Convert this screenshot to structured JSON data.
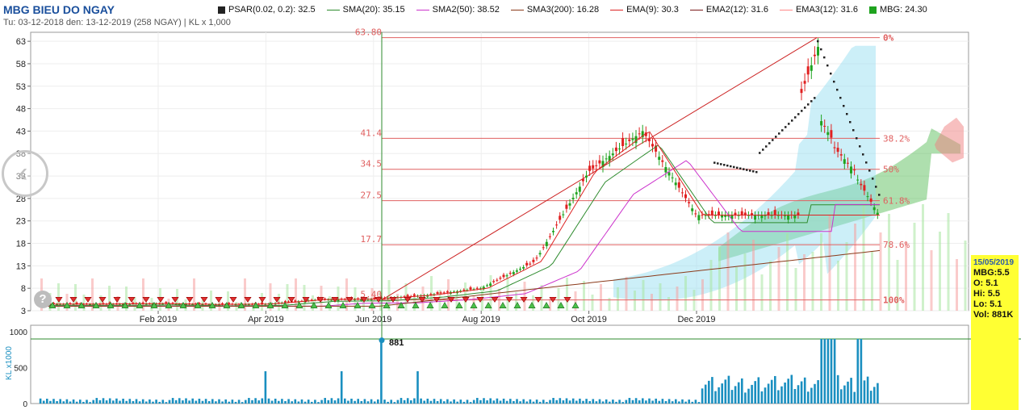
{
  "title": "MBG BIEU DO NGAY",
  "subtitle": "Tu: 03-12-2018 den: 13-12-2019 (258 NGAY) | KL x 1,000",
  "legend": [
    {
      "name": "PSAR(0.02, 0.2): 32.5",
      "color": "#222222",
      "kind": "square"
    },
    {
      "name": "SMA(20): 35.15",
      "color": "#2e8b2e",
      "kind": "line"
    },
    {
      "name": "SMA2(50): 38.52",
      "color": "#cc33cc",
      "kind": "line"
    },
    {
      "name": "SMA3(200): 16.28",
      "color": "#8b3a1a",
      "kind": "line"
    },
    {
      "name": "EMA(9): 30.3",
      "color": "#dd2222",
      "kind": "line"
    },
    {
      "name": "EMA2(12): 31.6",
      "color": "#7a1a1a",
      "kind": "line"
    },
    {
      "name": "EMA3(12): 31.6",
      "color": "#ff8888",
      "kind": "line"
    },
    {
      "name": "MBG: 24.30",
      "color": "#1fa31f",
      "kind": "square"
    }
  ],
  "info": {
    "date": "15/05/2019",
    "symbol": "MBG:5.5",
    "open": "O: 5.1",
    "high": "Hi: 5.5",
    "low": "Lo: 5.1",
    "vol": "Vol: 881K"
  },
  "colors": {
    "up": "#1fa31f",
    "down": "#e02020",
    "volume": "#1a8fc0",
    "fib": "#e06060",
    "cloud": "#4cb84c",
    "band": "#8fdcf0"
  },
  "chart_data": {
    "type": "candlestick",
    "title": "MBG BIEU DO NGAY",
    "x_tick_labels": [
      "Feb 2019",
      "Apr 2019",
      "Jun 2019",
      "Aug 2019",
      "Oct 2019",
      "Dec 2019"
    ],
    "x_tick_months": [
      2,
      4,
      6,
      8,
      10,
      12
    ],
    "y_ticks": [
      3,
      8,
      13,
      18,
      23,
      28,
      33,
      38,
      43,
      48,
      53,
      58,
      63
    ],
    "ylim": [
      3,
      65
    ],
    "volume_ticks": [
      0,
      500,
      1000
    ],
    "volume_ylabel": "KL x1000",
    "fib_levels": [
      {
        "price": 63.8,
        "label": "63.80",
        "pct": "0%"
      },
      {
        "price": 41.4,
        "label": "41.4",
        "pct": "38.2%"
      },
      {
        "price": 34.5,
        "label": "34.5",
        "pct": "50%"
      },
      {
        "price": 27.5,
        "label": "27.5",
        "pct": "61.8%"
      },
      {
        "price": 17.7,
        "label": "17.7",
        "pct": "78.6%"
      },
      {
        "price": 5.4,
        "label": "5.40",
        "pct": "100%"
      }
    ],
    "cursor_volume_label": "881",
    "close_monthly": [
      {
        "month": 1,
        "close": 4.5
      },
      {
        "month": 2,
        "close": 4.6
      },
      {
        "month": 3,
        "close": 4.4
      },
      {
        "month": 4,
        "close": 4.5
      },
      {
        "month": 5,
        "close": 5.5
      },
      {
        "month": 6,
        "close": 5.6
      },
      {
        "month": 7,
        "close": 6.5
      },
      {
        "month": 8,
        "close": 8.0
      },
      {
        "month": 9,
        "close": 14.0
      },
      {
        "month": 10,
        "close": 34.0
      },
      {
        "month": 11,
        "close": 43.0
      },
      {
        "month": 12,
        "close": 24.3
      }
    ],
    "last": {
      "close": 24.3,
      "psar": 32.5,
      "sma20": 35.15,
      "sma50": 38.52,
      "sma200": 16.28,
      "ema9": 30.3,
      "ema12": 31.6
    }
  }
}
